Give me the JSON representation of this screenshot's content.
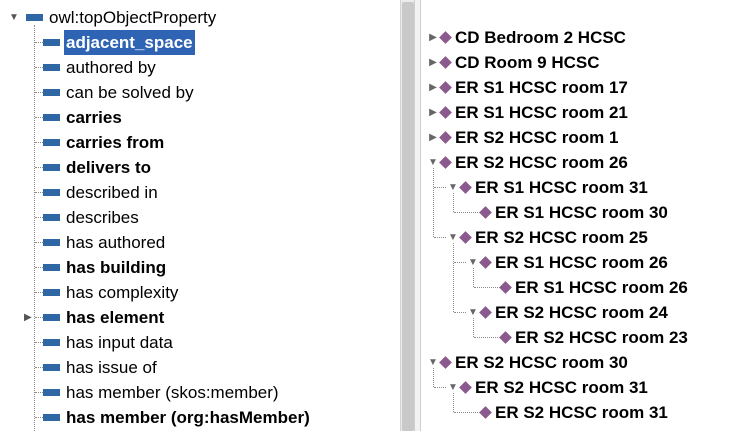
{
  "left_tree": {
    "root": {
      "label": "owl:topObjectProperty",
      "expanded": true
    },
    "items": [
      {
        "label": "adjacent_space",
        "bold": true,
        "selected": true
      },
      {
        "label": "authored by",
        "bold": false
      },
      {
        "label": "can be solved by",
        "bold": false
      },
      {
        "label": "carries",
        "bold": true
      },
      {
        "label": "carries from",
        "bold": true
      },
      {
        "label": "delivers to",
        "bold": true
      },
      {
        "label": "described in",
        "bold": false
      },
      {
        "label": "describes",
        "bold": false
      },
      {
        "label": "has authored",
        "bold": false
      },
      {
        "label": "has building",
        "bold": true
      },
      {
        "label": "has complexity",
        "bold": false
      },
      {
        "label": "has element",
        "bold": true,
        "has_children": true
      },
      {
        "label": "has input data",
        "bold": false
      },
      {
        "label": "has issue of",
        "bold": false
      },
      {
        "label": "has member (skos:member)",
        "bold": false
      },
      {
        "label": "has member (org:hasMember)",
        "bold": true
      }
    ],
    "colors": {
      "property_bar": "#2f67a5",
      "selection_bg": "#2f64b4"
    }
  },
  "right_tree": {
    "items": [
      {
        "label": "CD Bedroom 2 HCSC",
        "level": 0,
        "state": "collapsed"
      },
      {
        "label": "CD Room 9 HCSC",
        "level": 0,
        "state": "collapsed"
      },
      {
        "label": "ER S1 HCSC room 17",
        "level": 0,
        "state": "collapsed"
      },
      {
        "label": "ER S1 HCSC room 21",
        "level": 0,
        "state": "collapsed"
      },
      {
        "label": "ER S2 HCSC room 1",
        "level": 0,
        "state": "collapsed"
      },
      {
        "label": "ER S2 HCSC room 26",
        "level": 0,
        "state": "expanded"
      },
      {
        "label": "ER S1 HCSC room 31",
        "level": 1,
        "state": "expanded"
      },
      {
        "label": "ER S1 HCSC room 30",
        "level": 2,
        "state": "leaf"
      },
      {
        "label": "ER S2 HCSC room 25",
        "level": 1,
        "state": "expanded"
      },
      {
        "label": "ER S1 HCSC room 26",
        "level": 2,
        "state": "expanded"
      },
      {
        "label": "ER S1 HCSC room 26",
        "level": 3,
        "state": "leaf"
      },
      {
        "label": "ER S2 HCSC room 24",
        "level": 2,
        "state": "expanded"
      },
      {
        "label": "ER S2 HCSC room 23",
        "level": 3,
        "state": "leaf"
      },
      {
        "label": "ER S2 HCSC room 30",
        "level": 0,
        "state": "expanded"
      },
      {
        "label": "ER S2 HCSC room 31",
        "level": 1,
        "state": "expanded"
      },
      {
        "label": "ER S2 HCSC room 31",
        "level": 2,
        "state": "leaf"
      }
    ],
    "colors": {
      "individual_diamond": "#8a5a8f"
    }
  }
}
